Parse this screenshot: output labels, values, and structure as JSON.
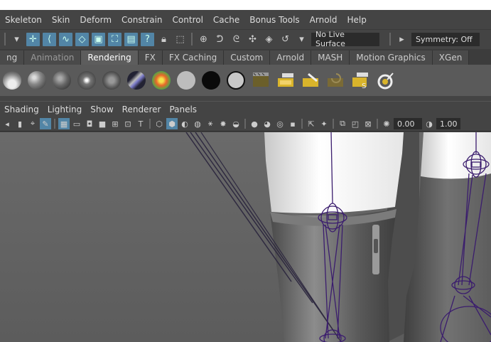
{
  "menubar": {
    "items": [
      "Skeleton",
      "Skin",
      "Deform",
      "Constrain",
      "Control",
      "Cache",
      "Bonus Tools",
      "Arnold",
      "Help"
    ]
  },
  "statusline": {
    "live_surface": "No Live Surface",
    "symmetry": "Symmetry: Off"
  },
  "shelf": {
    "tabs": [
      "ng",
      "Animation",
      "Rendering",
      "FX",
      "FX Caching",
      "Custom",
      "Arnold",
      "MASH",
      "Motion Graphics",
      "XGen"
    ],
    "active_tab": "Rendering"
  },
  "panel": {
    "menus": [
      "Shading",
      "Lighting",
      "Show",
      "Renderer",
      "Panels"
    ],
    "exposure_value": "0.00",
    "gamma_value": "1.00"
  },
  "colors": {
    "accent": "#5285a6",
    "ui_bg": "#444444",
    "viewport_bg": "#5f5f5f",
    "joint_wire": "#3b1d6e"
  }
}
